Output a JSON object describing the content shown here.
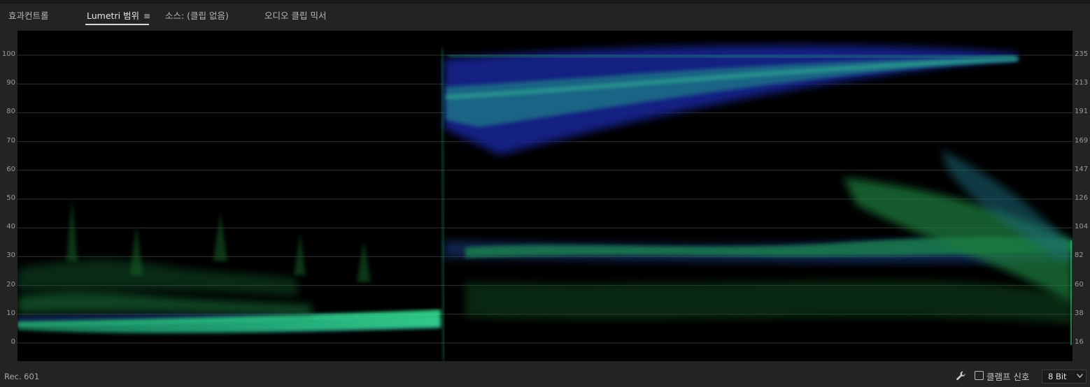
{
  "tabs": [
    {
      "label": "효과컨트롤",
      "active": false
    },
    {
      "label": "Lumetri 범위",
      "active": true
    },
    {
      "label": "소스: (클립 없음)",
      "active": false
    },
    {
      "label": "오디오 클립 믹서",
      "active": false
    }
  ],
  "menu_icon": "hamburger-icon",
  "scope": {
    "type": "waveform",
    "left_scale": [
      "100",
      "90",
      "80",
      "70",
      "60",
      "50",
      "40",
      "30",
      "20",
      "10",
      "0"
    ],
    "right_scale": [
      "235",
      "213",
      "191",
      "169",
      "147",
      "126",
      "104",
      "82",
      "60",
      "38",
      "16"
    ],
    "trace_color": "#2fe08a",
    "shadow_color": "#1c2aa6"
  },
  "footer": {
    "standard": "Rec. 601",
    "settings_icon": "wrench-icon",
    "clamp_label": "클램프 신호",
    "clamp_checked": false,
    "bit_depth": "8 Bit"
  }
}
